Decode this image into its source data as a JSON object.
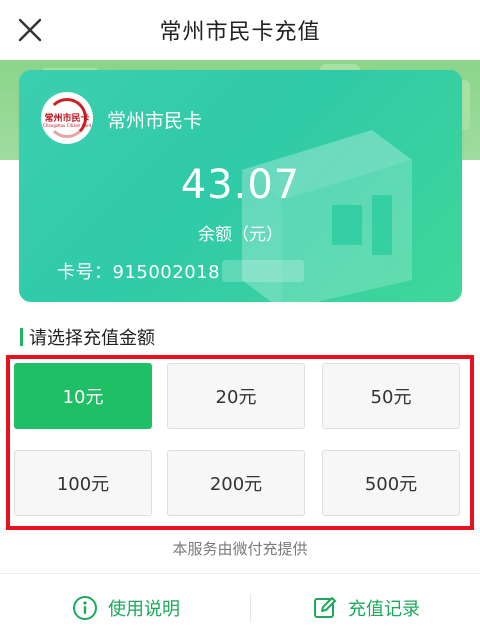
{
  "header": {
    "title": "常州市民卡充值"
  },
  "card": {
    "name": "常州市民卡",
    "logo_text": "常州市民卡",
    "logo_sub": "Changzhou Citizen Card",
    "balance": "43.07",
    "balance_label": "余额（元）",
    "card_number_label": "卡号：",
    "card_number": "915002018"
  },
  "recharge": {
    "section_title": "请选择充值金额",
    "options": [
      "10元",
      "20元",
      "50元",
      "100元",
      "200元",
      "500元"
    ],
    "selected": "10元"
  },
  "provider_note": "本服务由微付充提供",
  "footer": {
    "help_label": "使用说明",
    "records_label": "充值记录"
  },
  "colors": {
    "accent": "#1fbf66",
    "card": "#36cdb0",
    "highlight": "#e8101d"
  }
}
